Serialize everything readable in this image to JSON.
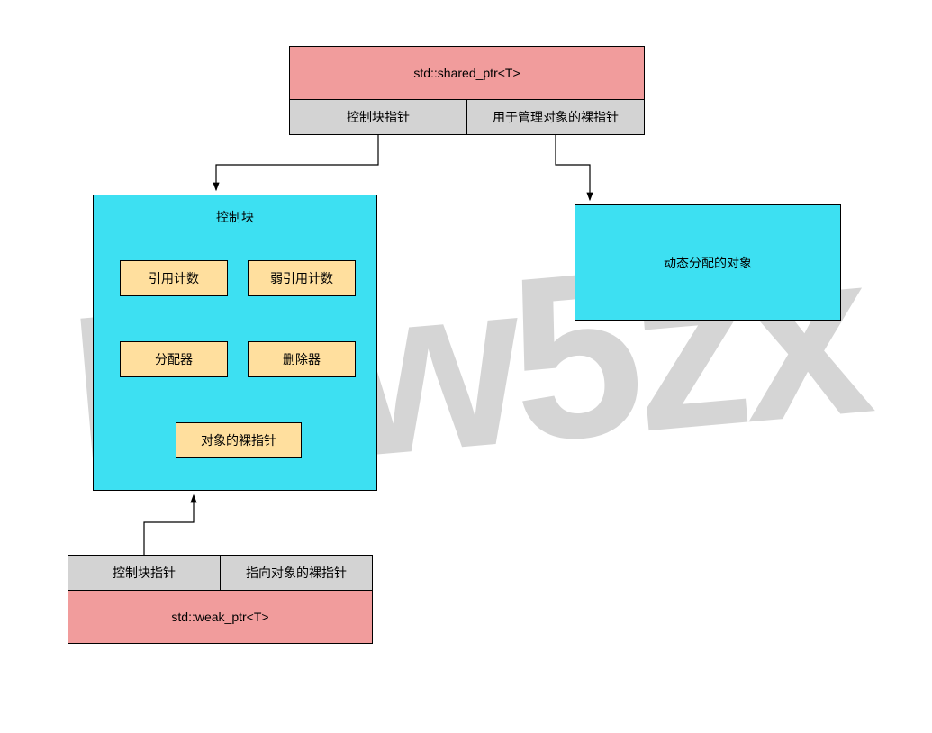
{
  "watermark": "Paw5zx",
  "shared_ptr": {
    "title": "std::shared_ptr<T>",
    "left": "控制块指针",
    "right": "用于管理对象的裸指针"
  },
  "control_block": {
    "title": "控制块",
    "ref_count": "引用计数",
    "weak_ref_count": "弱引用计数",
    "allocator": "分配器",
    "deleter": "删除器",
    "raw_ptr": "对象的裸指针"
  },
  "dyn_obj": "动态分配的对象",
  "weak_ptr": {
    "left": "控制块指针",
    "right": "指向对象的裸指针",
    "title": "std::weak_ptr<T>"
  },
  "colors": {
    "pink": "#f19c9c",
    "gray": "#d3d3d3",
    "cyan": "#3de0f2",
    "peach": "#ffdf9e",
    "watermark": "#b3b3b3"
  }
}
